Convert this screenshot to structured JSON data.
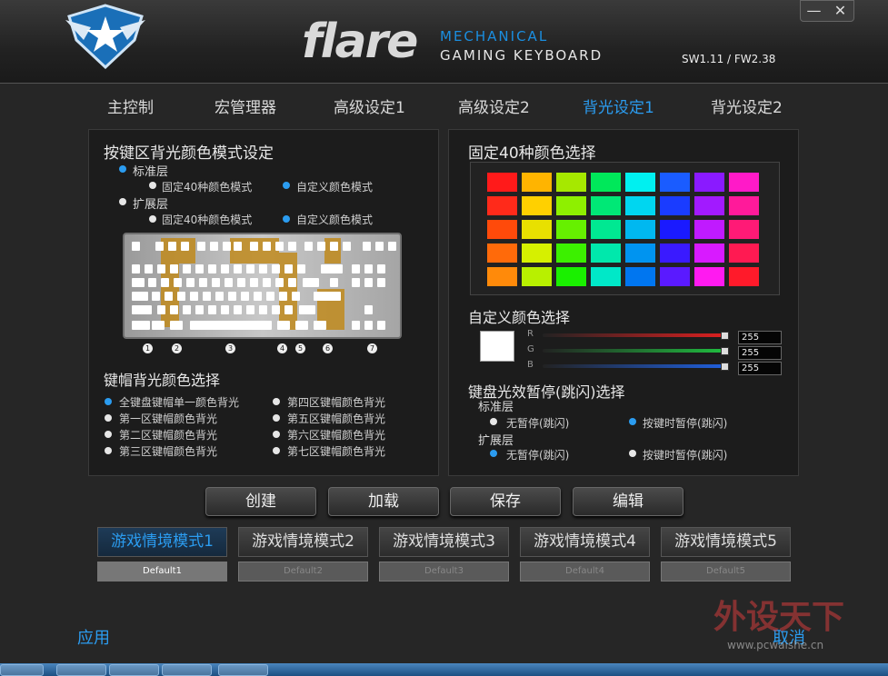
{
  "app": {
    "brand": "flare",
    "subtitle1": "MECHANICAL",
    "subtitle2": "GAMING KEYBOARD",
    "version": "SW1.11 / FW2.38",
    "min": "—",
    "close": "✕"
  },
  "tabs": [
    "主控制",
    "宏管理器",
    "高级设定1",
    "高级设定2",
    "背光设定1",
    "背光设定2"
  ],
  "left": {
    "title": "按键区背光颜色模式设定",
    "std_layer": "标准层",
    "fixed40": "固定40种颜色模式",
    "custom": "自定义颜色模式",
    "ext_layer": "扩展层",
    "fixed40b": "固定40种颜色模式",
    "customb": "自定义颜色模式",
    "zones": [
      "1",
      "2",
      "3",
      "4",
      "5",
      "6",
      "7"
    ],
    "keycap_title": "键帽背光颜色选择",
    "keycap_opts": [
      "全键盘键帽单一颜色背光",
      "第一区键帽颜色背光",
      "第二区键帽颜色背光",
      "第三区键帽颜色背光",
      "第四区键帽颜色背光",
      "第五区键帽颜色背光",
      "第六区键帽颜色背光",
      "第七区键帽颜色背光"
    ]
  },
  "right": {
    "title": "固定40种颜色选择",
    "colors": [
      [
        "#ff1a1a",
        "#ffb400",
        "#a6e800",
        "#00e85a",
        "#00f0f0",
        "#1a5cff",
        "#8a1aff",
        "#ff1ac8"
      ],
      [
        "#ff2a1a",
        "#ffd000",
        "#8ef000",
        "#00e876",
        "#00d6f0",
        "#1a3cff",
        "#a21aff",
        "#ff1a9a"
      ],
      [
        "#ff4a0a",
        "#e8e000",
        "#66f000",
        "#00e892",
        "#00b8f0",
        "#1a1aff",
        "#c01aff",
        "#ff1a76"
      ],
      [
        "#ff6a0a",
        "#d6f000",
        "#3cf000",
        "#00e8ac",
        "#0094f0",
        "#3a1aff",
        "#d81aff",
        "#ff1a52"
      ],
      [
        "#ff8a0a",
        "#b8f000",
        "#1af000",
        "#00e8c8",
        "#0076f0",
        "#5a1aff",
        "#ff1af0",
        "#ff1a2a"
      ]
    ],
    "custom_title": "自定义颜色选择",
    "rgb": [
      {
        "label": "R",
        "value": "255"
      },
      {
        "label": "G",
        "value": "255"
      },
      {
        "label": "B",
        "value": "255"
      }
    ],
    "pause_title": "键盘光效暂停(跳闪)选择",
    "std_layer": "标准层",
    "no_pause": "无暂停(跳闪)",
    "key_pause": "按键时暂停(跳闪)",
    "ext_layer": "扩展层",
    "no_pause2": "无暂停(跳闪)",
    "key_pause2": "按键时暂停(跳闪)"
  },
  "buttons": {
    "create": "创建",
    "load": "加载",
    "save": "保存",
    "edit": "编辑"
  },
  "modes": [
    "游戏情境模式1",
    "游戏情境模式2",
    "游戏情境模式3",
    "游戏情境模式4",
    "游戏情境模式5"
  ],
  "profiles": [
    "Default1",
    "Default2",
    "Default3",
    "Default4",
    "Default5"
  ],
  "footer": {
    "apply": "应用",
    "cancel": "取消"
  },
  "watermark": {
    "text": "外设天下",
    "url": "www.pcwaishe.cn"
  }
}
